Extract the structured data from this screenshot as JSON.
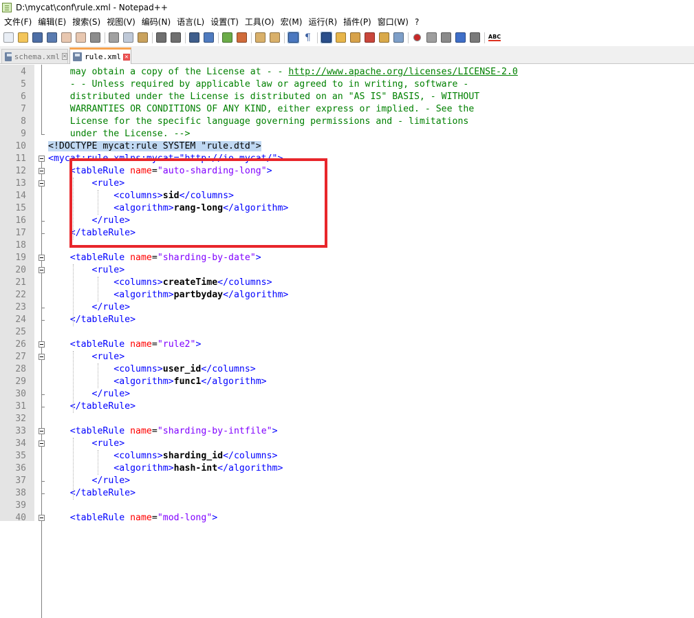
{
  "window": {
    "title": "D:\\mycat\\conf\\rule.xml - Notepad++"
  },
  "menu": [
    "文件(F)",
    "编辑(E)",
    "搜索(S)",
    "视图(V)",
    "编码(N)",
    "语言(L)",
    "设置(T)",
    "工具(O)",
    "宏(M)",
    "运行(R)",
    "插件(P)",
    "窗口(W)",
    "?"
  ],
  "toolbar": {
    "icons": [
      "new-file-icon",
      "open-file-icon",
      "save-icon",
      "save-all-icon",
      "close-icon",
      "close-all-icon",
      "print-icon",
      "|",
      "cut-icon",
      "copy-icon",
      "paste-icon",
      "|",
      "undo-icon",
      "redo-icon",
      "|",
      "find-icon",
      "replace-icon",
      "|",
      "zoom-in-icon",
      "zoom-out-icon",
      "|",
      "sync-vertical-icon",
      "sync-horizontal-icon",
      "|",
      "word-wrap-icon",
      "show-all-chars-icon",
      "|",
      "indent-guide-icon",
      "user-lang-icon",
      "doc-map-icon",
      "function-list-icon",
      "folder-workspace-icon",
      "monitoring-icon",
      "|",
      "record-macro-icon",
      "stop-record-icon",
      "play-macro-icon",
      "run-macro-multiple-icon",
      "save-macro-icon",
      "|",
      "spell-check-icon"
    ],
    "spell_label": "ABC"
  },
  "tabs": [
    {
      "label": "schema.xml",
      "active": false
    },
    {
      "label": "rule.xml",
      "active": true
    }
  ],
  "editor": {
    "lines": [
      {
        "n": "4",
        "text": "may obtain a copy of the License at - - ",
        "link": "http://www.apache.org/licenses/LICENSE-2.0"
      },
      {
        "n": "5",
        "text": "- - Unless required by applicable law or agreed to in writing, software -"
      },
      {
        "n": "6",
        "text": "distributed under the License is distributed on an \"AS IS\" BASIS, - WITHOUT"
      },
      {
        "n": "7",
        "text": "WARRANTIES OR CONDITIONS OF ANY KIND, either express or implied. - See the"
      },
      {
        "n": "8",
        "text": "License for the specific language governing permissions and - limitations"
      },
      {
        "n": "9",
        "text": "under the License. -->"
      },
      {
        "n": "10",
        "doctype": "<!DOCTYPE mycat:rule SYSTEM \"rule.dtd\">"
      },
      {
        "n": "11",
        "root_tag": "<mycat:rule xmlns:mycat=\"http://io.mycat/\">"
      },
      {
        "n": "12",
        "rule_name": "auto-sharding-long"
      },
      {
        "n": "13",
        "rule_open": "<rule>"
      },
      {
        "n": "14",
        "columns": "sid"
      },
      {
        "n": "15",
        "algorithm": "rang-long"
      },
      {
        "n": "16",
        "rule_close": "</rule>"
      },
      {
        "n": "17",
        "table_close": "</tableRule>"
      },
      {
        "n": "18"
      },
      {
        "n": "19",
        "rule_name": "sharding-by-date"
      },
      {
        "n": "20",
        "rule_open": "<rule>"
      },
      {
        "n": "21",
        "columns": "createTime"
      },
      {
        "n": "22",
        "algorithm": "partbyday"
      },
      {
        "n": "23",
        "rule_close": "</rule>"
      },
      {
        "n": "24",
        "table_close": "</tableRule>"
      },
      {
        "n": "25"
      },
      {
        "n": "26",
        "rule_name": "rule2"
      },
      {
        "n": "27",
        "rule_open": "<rule>"
      },
      {
        "n": "28",
        "columns": "user_id"
      },
      {
        "n": "29",
        "algorithm": "func1"
      },
      {
        "n": "30",
        "rule_close": "</rule>"
      },
      {
        "n": "31",
        "table_close": "</tableRule>"
      },
      {
        "n": "32"
      },
      {
        "n": "33",
        "rule_name": "sharding-by-intfile"
      },
      {
        "n": "34",
        "rule_open": "<rule>"
      },
      {
        "n": "35",
        "columns": "sharding_id"
      },
      {
        "n": "36",
        "algorithm": "hash-int"
      },
      {
        "n": "37",
        "rule_close": "</rule>"
      },
      {
        "n": "38",
        "table_close": "</tableRule>"
      },
      {
        "n": "39"
      },
      {
        "n": "40",
        "rule_name": "mod-long"
      }
    ]
  },
  "colors": {
    "highlight_box": "#e8262b",
    "tab_accent": "#f7a34f"
  }
}
